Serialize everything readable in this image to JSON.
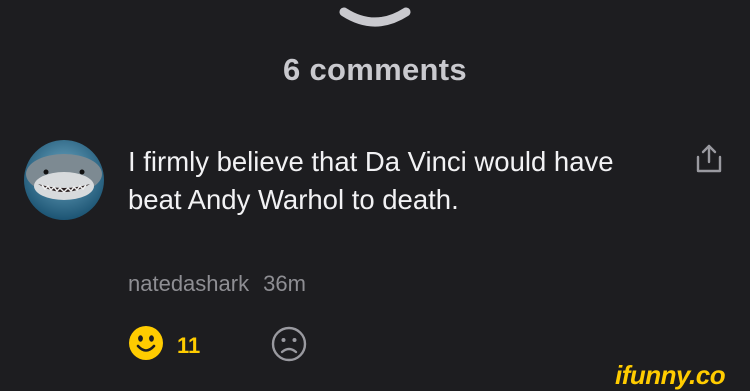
{
  "comments_header": {
    "count_label": "6 comments"
  },
  "comment": {
    "text": "I firmly believe that Da Vinci would have beat Andy Warhol to death.",
    "username": "natedashark",
    "time": "36m",
    "like_count": "11"
  },
  "watermark": {
    "text": "ifunny.co"
  },
  "colors": {
    "background": "#1d1d20",
    "accent": "#ffcc00",
    "secondary_text": "#8e8e93"
  },
  "icons": [
    "chevron-down-icon",
    "share-icon",
    "smile-icon",
    "frown-icon"
  ]
}
